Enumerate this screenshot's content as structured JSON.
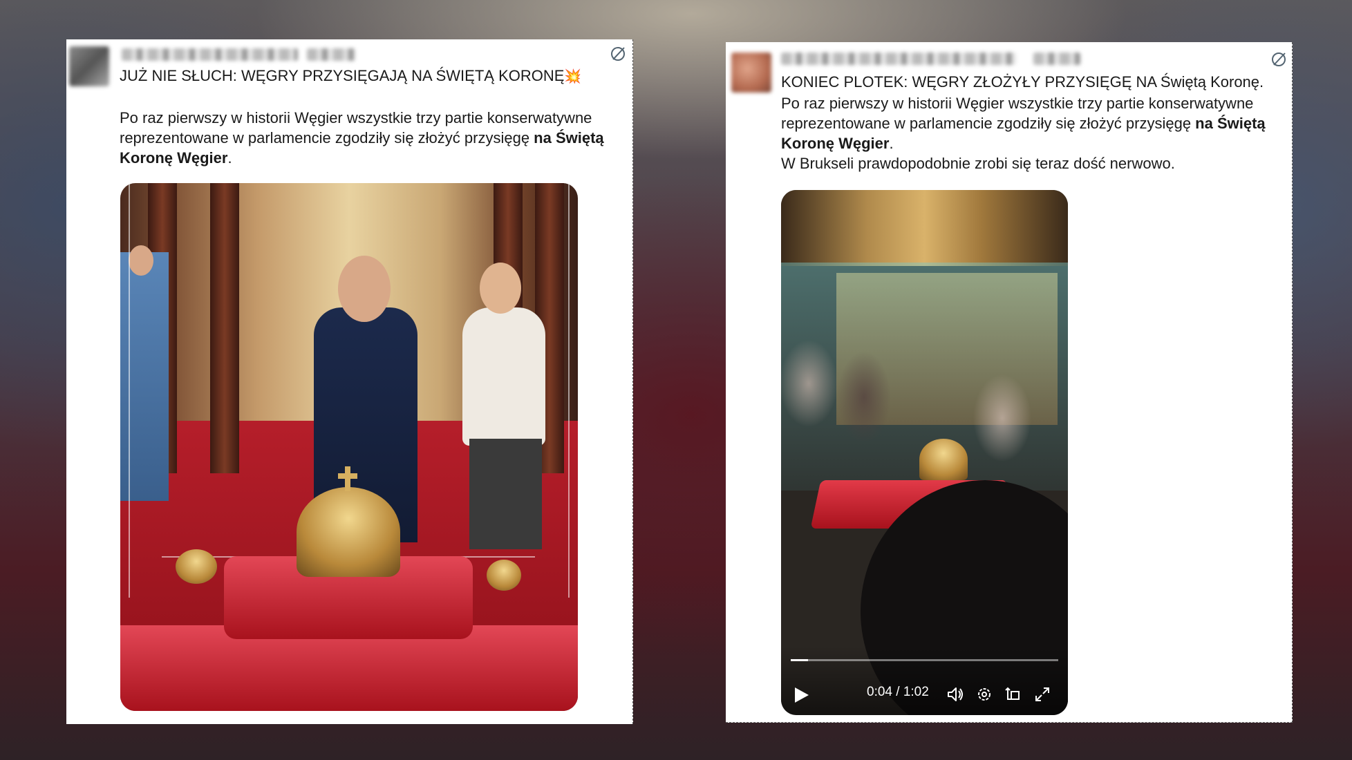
{
  "post_left": {
    "headline": "JUŻ NIE SŁUCH: WĘGRY PRZYSIĘGAJĄ NA ŚWIĘTĄ KORONĘ",
    "headline_emoji": "💥",
    "body_text": "Po raz pierwszy w historii Węgier wszystkie trzy partie konserwatywne reprezentowane w parlamencie zgodziły się złożyć przysięgę ",
    "body_bold": "na Świętą Koronę Węgier",
    "body_end": ".",
    "icon": "grok-icon"
  },
  "post_right": {
    "headline": "KONIEC PLOTEK: WĘGRY ZŁOŻYŁY PRZYSIĘGĘ NA Świętą Koronę.",
    "body_text": "Po raz pierwszy w historii Węgier wszystkie trzy partie konserwatywne reprezentowane w parlamencie zgodziły się złożyć przysięgę ",
    "body_bold": "na Świętą Koronę Węgier",
    "body_end": ".",
    "body_line2": "W Brukseli prawdopodobnie zrobi się teraz dość nerwowo.",
    "icon": "grok-icon",
    "video": {
      "time": "0:04 / 1:02",
      "progress_fraction": 0.065
    }
  }
}
